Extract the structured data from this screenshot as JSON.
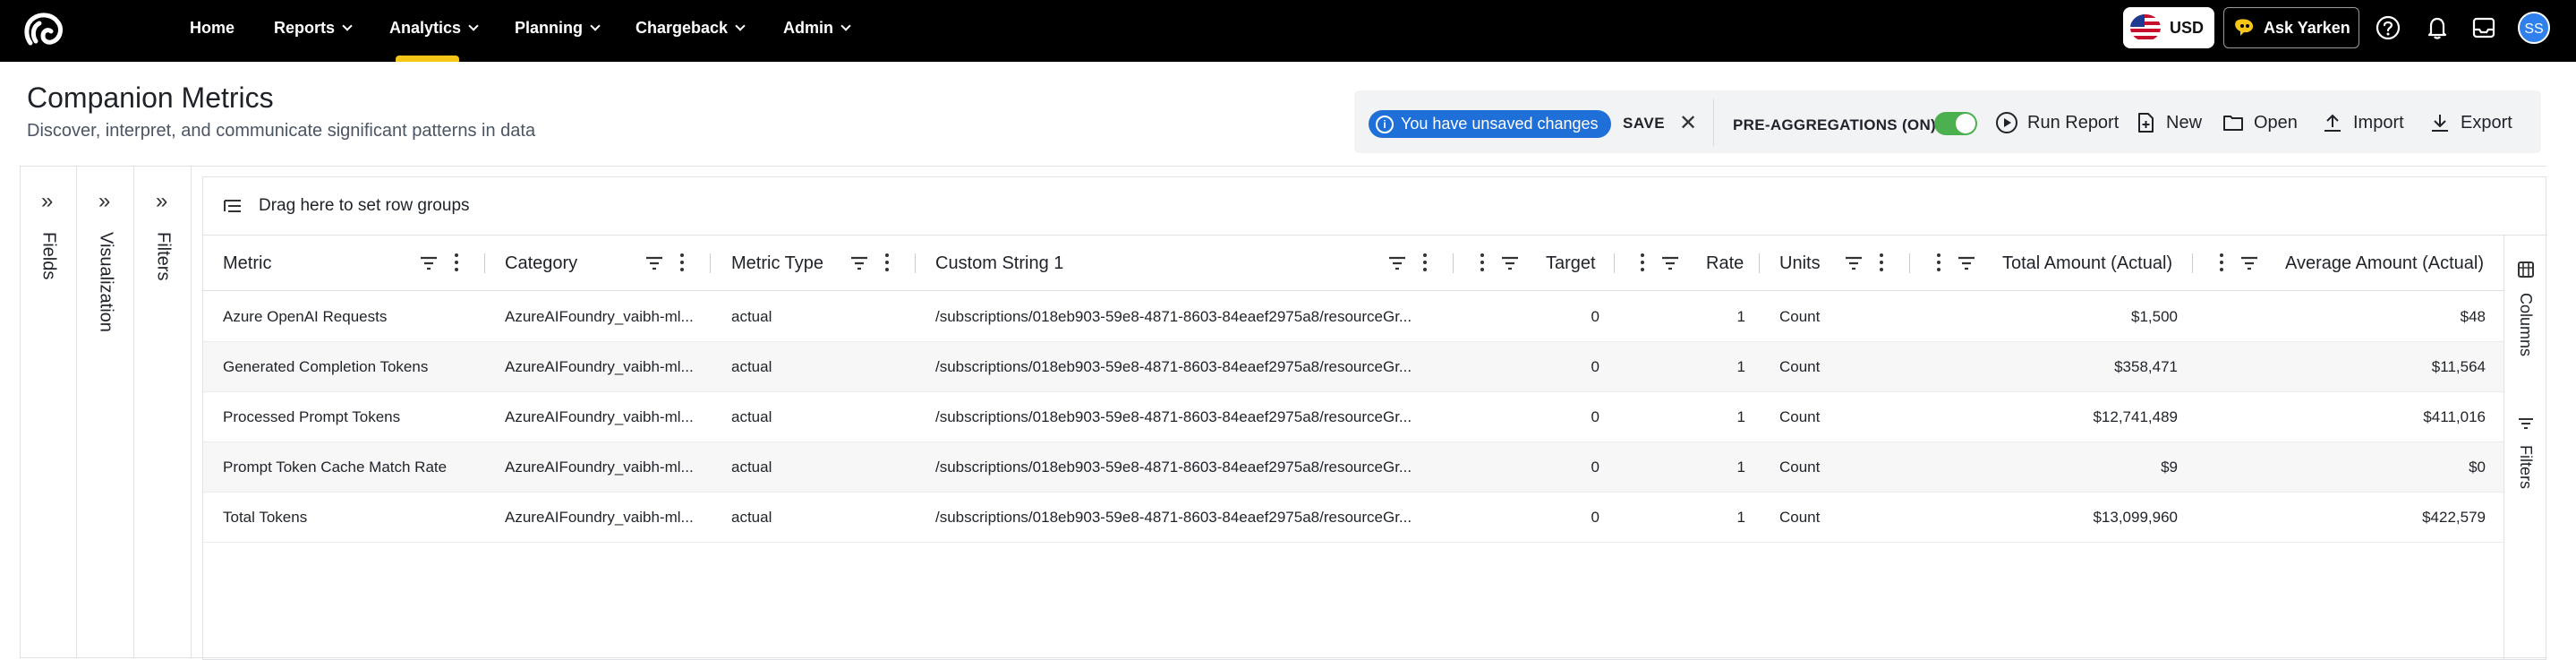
{
  "nav": {
    "items": [
      {
        "label": "Home",
        "dropdown": false
      },
      {
        "label": "Reports",
        "dropdown": true
      },
      {
        "label": "Analytics",
        "dropdown": true
      },
      {
        "label": "Planning",
        "dropdown": true
      },
      {
        "label": "Chargeback",
        "dropdown": true
      },
      {
        "label": "Admin",
        "dropdown": true
      }
    ],
    "active": "Analytics",
    "currency": "USD",
    "ask_label": "Ask Yarken",
    "avatar_initials": "SS",
    "accent": "#f5c518"
  },
  "header": {
    "title": "Companion Metrics",
    "subtitle": "Discover, interpret, and communicate significant patterns in data"
  },
  "toolbar": {
    "unsaved_label": "You have unsaved changes",
    "save_label": "SAVE",
    "preagg_label": "PRE-AGGREGATIONS (ON)",
    "preagg_on": true,
    "run_label": "Run Report",
    "new_label": "New",
    "open_label": "Open",
    "import_label": "Import",
    "export_label": "Export"
  },
  "side_tabs": {
    "fields": "Fields",
    "visualization": "Visualization",
    "filters": "Filters"
  },
  "grid": {
    "rowgroup_label": "Drag here to set row groups",
    "columns": {
      "metric": "Metric",
      "category": "Category",
      "metric_type": "Metric Type",
      "custom_string": "Custom String 1",
      "target": "Target",
      "rate": "Rate",
      "units": "Units",
      "total_amount": "Total Amount (Actual)",
      "average_amount": "Average Amount (Actual)"
    },
    "rows": [
      {
        "metric": "Azure OpenAI Requests",
        "category": "AzureAIFoundry_vaibh-ml...",
        "metric_type": "actual",
        "custom_string": "/subscriptions/018eb903-59e8-4871-8603-84eaef2975a8/resourceGr...",
        "target": "0",
        "rate": "1",
        "units": "Count",
        "total": "$1,500",
        "average": "$48"
      },
      {
        "metric": "Generated Completion Tokens",
        "category": "AzureAIFoundry_vaibh-ml...",
        "metric_type": "actual",
        "custom_string": "/subscriptions/018eb903-59e8-4871-8603-84eaef2975a8/resourceGr...",
        "target": "0",
        "rate": "1",
        "units": "Count",
        "total": "$358,471",
        "average": "$11,564"
      },
      {
        "metric": "Processed Prompt Tokens",
        "category": "AzureAIFoundry_vaibh-ml...",
        "metric_type": "actual",
        "custom_string": "/subscriptions/018eb903-59e8-4871-8603-84eaef2975a8/resourceGr...",
        "target": "0",
        "rate": "1",
        "units": "Count",
        "total": "$12,741,489",
        "average": "$411,016"
      },
      {
        "metric": "Prompt Token Cache Match Rate",
        "category": "AzureAIFoundry_vaibh-ml...",
        "metric_type": "actual",
        "custom_string": "/subscriptions/018eb903-59e8-4871-8603-84eaef2975a8/resourceGr...",
        "target": "0",
        "rate": "1",
        "units": "Count",
        "total": "$9",
        "average": "$0"
      },
      {
        "metric": "Total Tokens",
        "category": "AzureAIFoundry_vaibh-ml...",
        "metric_type": "actual",
        "custom_string": "/subscriptions/018eb903-59e8-4871-8603-84eaef2975a8/resourceGr...",
        "target": "0",
        "rate": "1",
        "units": "Count",
        "total": "$13,099,960",
        "average": "$422,579"
      }
    ],
    "right_tabs": {
      "columns": "Columns",
      "filters": "Filters"
    }
  }
}
